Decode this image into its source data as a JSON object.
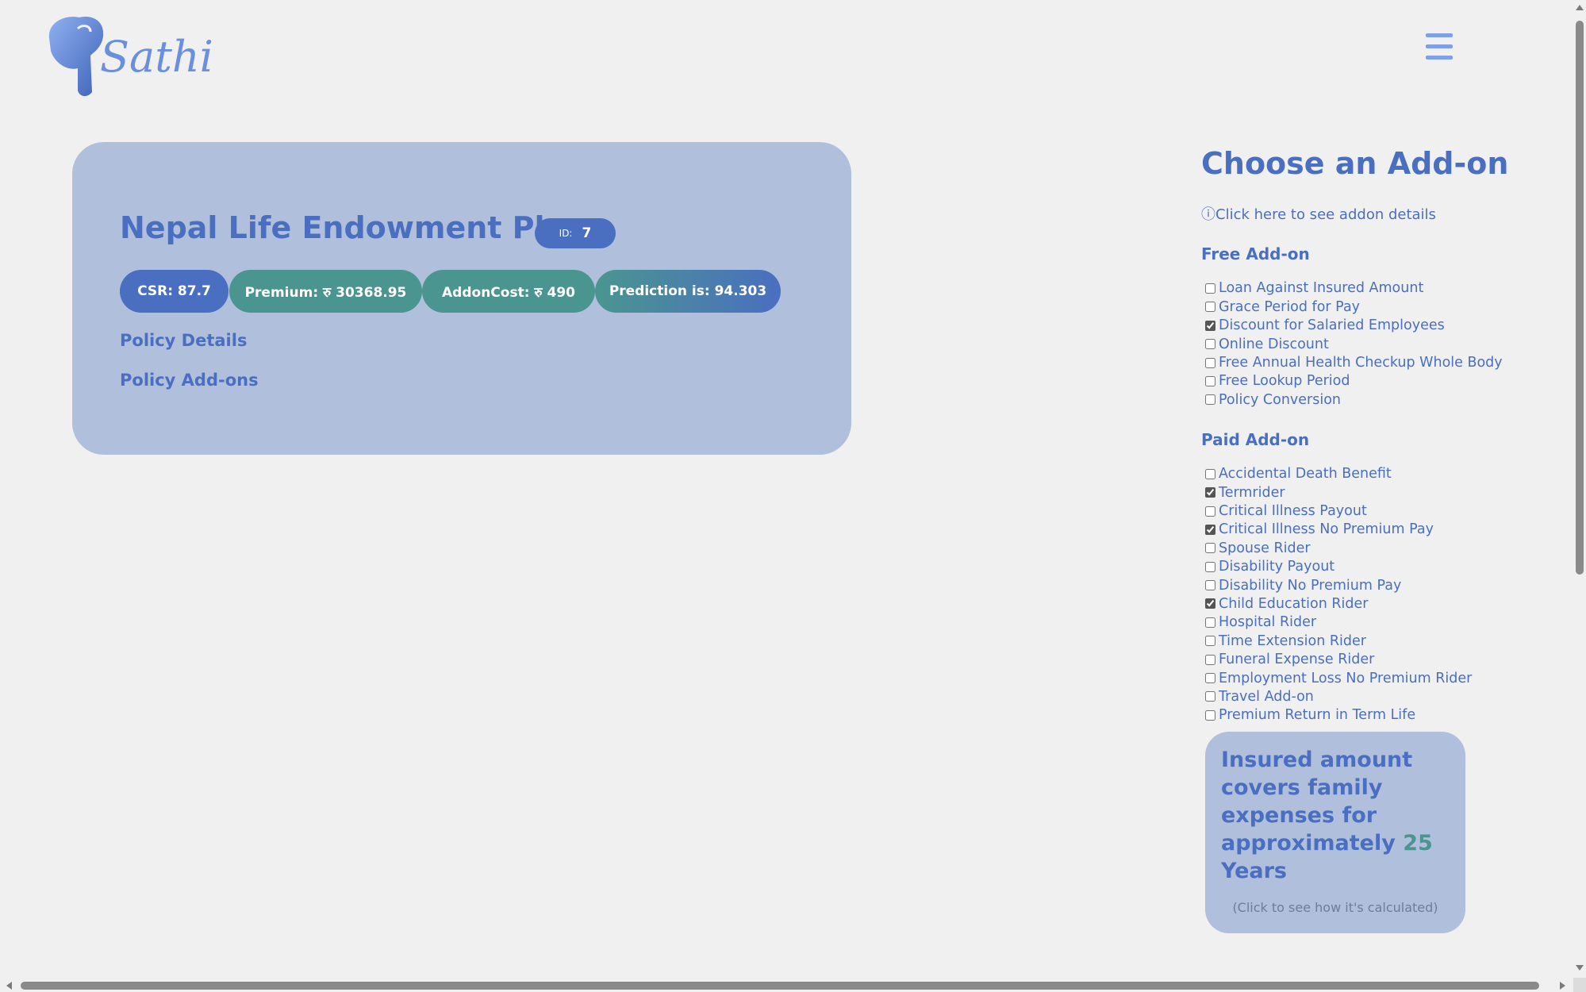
{
  "brand": {
    "logo_text": "Sathi"
  },
  "plan": {
    "title": "Nepal Life Endowment Plan",
    "id_label": "ID:",
    "id_value": "7",
    "csr": "CSR: 87.7",
    "premium": "Premium: रु 30368.95",
    "addon_cost": "AddonCost: रु 490",
    "prediction": "Prediction is: 94.303",
    "policy_details": "Policy Details",
    "policy_addons": "Policy Add-ons"
  },
  "addons": {
    "title": "Choose an Add-on",
    "info_link": "ⓘClick here to see addon details",
    "free_heading": "Free Add-on",
    "free": [
      {
        "label": "Loan Against Insured Amount",
        "checked": false
      },
      {
        "label": "Grace Period for Pay",
        "checked": false
      },
      {
        "label": "Discount for Salaried Employees",
        "checked": true
      },
      {
        "label": "Online Discount",
        "checked": false
      },
      {
        "label": "Free Annual Health Checkup Whole Body",
        "checked": false
      },
      {
        "label": "Free Lookup Period",
        "checked": false
      },
      {
        "label": "Policy Conversion",
        "checked": false
      }
    ],
    "paid_heading": "Paid Add-on",
    "paid": [
      {
        "label": "Accidental Death Benefit",
        "checked": false
      },
      {
        "label": "Termrider",
        "checked": true
      },
      {
        "label": "Critical Illness Payout",
        "checked": false
      },
      {
        "label": "Critical Illness No Premium Pay",
        "checked": true
      },
      {
        "label": "Spouse Rider",
        "checked": false
      },
      {
        "label": "Disability Payout",
        "checked": false
      },
      {
        "label": "Disability No Premium Pay",
        "checked": false
      },
      {
        "label": "Child Education Rider",
        "checked": true
      },
      {
        "label": "Hospital Rider",
        "checked": false
      },
      {
        "label": "Time Extension Rider",
        "checked": false
      },
      {
        "label": "Funeral Expense Rider",
        "checked": false
      },
      {
        "label": "Employment Loss No Premium Rider",
        "checked": false
      },
      {
        "label": "Travel Add-on",
        "checked": false
      },
      {
        "label": "Premium Return in Term Life",
        "checked": false
      }
    ]
  },
  "coverage": {
    "text": "Insured amount covers family expenses for approximately",
    "years_value": "25",
    "years_unit": "Years",
    "note": "(Click to see how it's calculated)"
  }
}
